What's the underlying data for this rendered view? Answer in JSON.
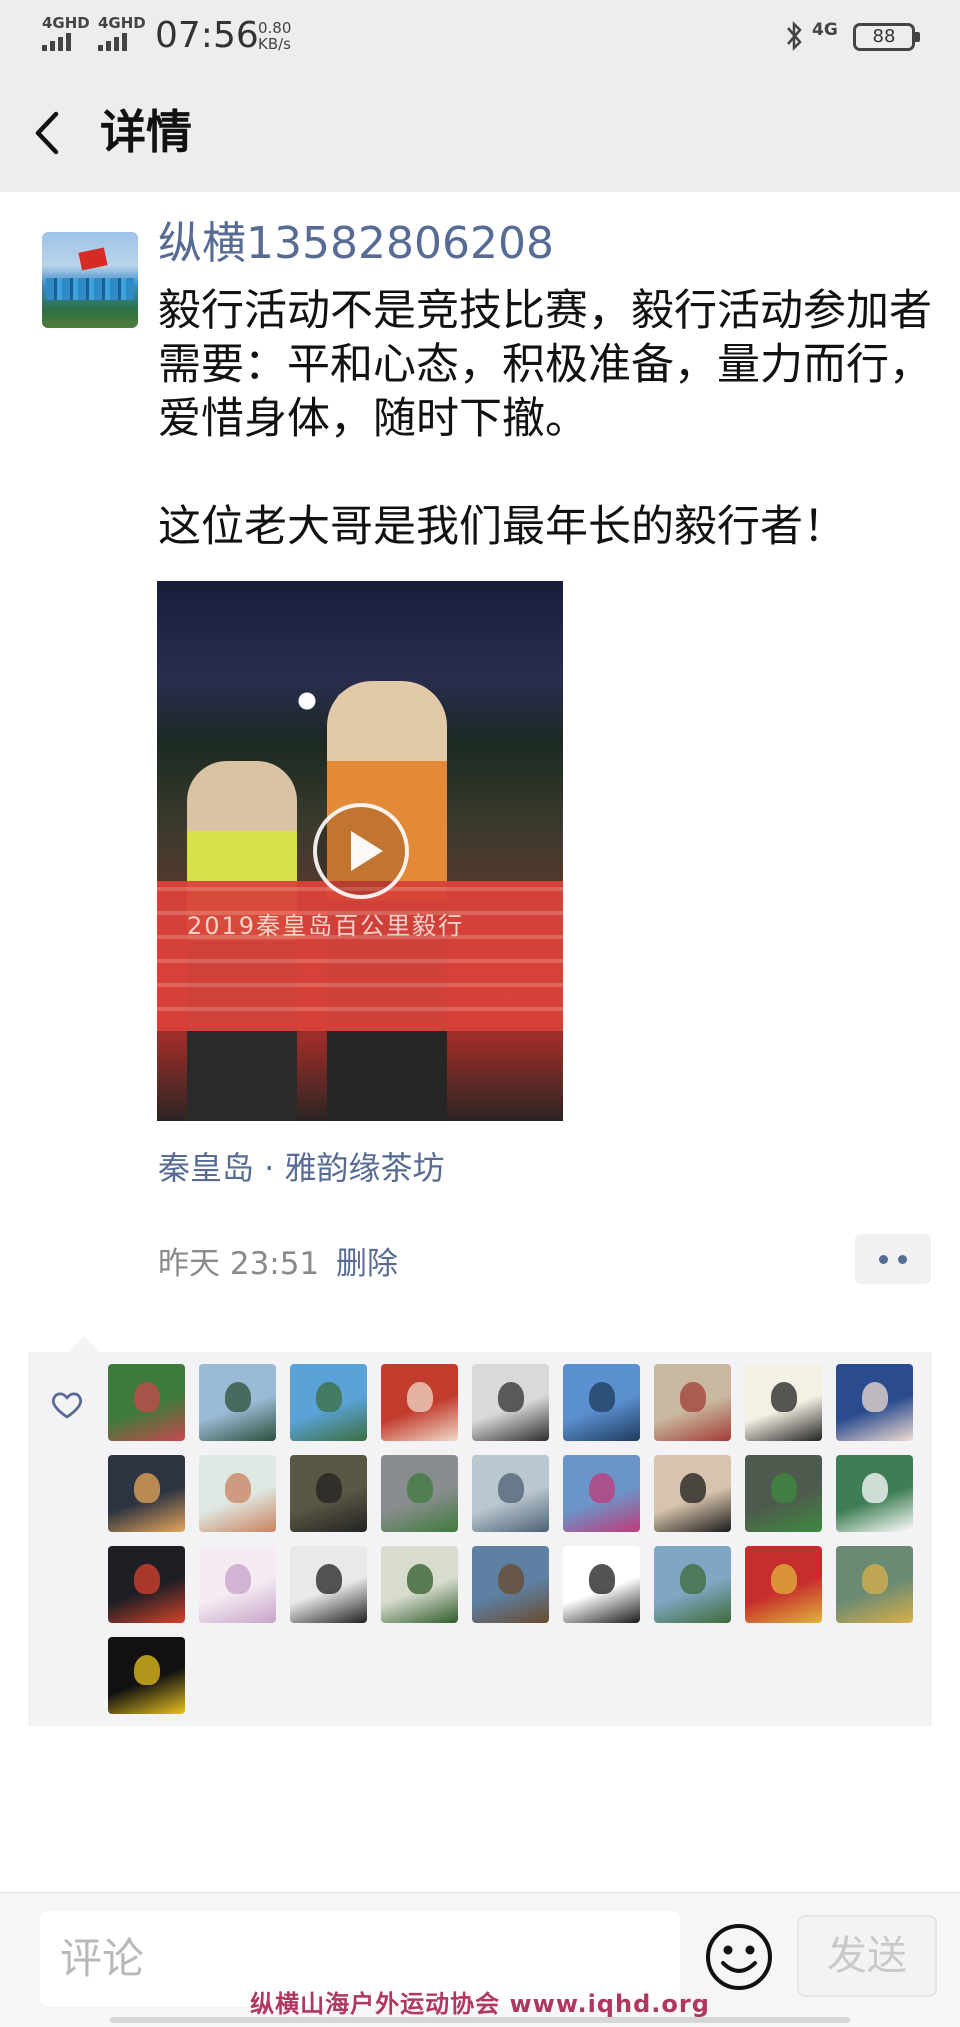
{
  "status_bar": {
    "network_label": "4GHD",
    "time": "07:56",
    "speed_value": "0.80",
    "speed_unit": "KB/s",
    "secondary_network": "4G",
    "battery": "88"
  },
  "header": {
    "title": "详情"
  },
  "post": {
    "username": "纵横13582806208",
    "text": "毅行活动不是竞技比赛，毅行活动参加者需要：平和心态，积极准备，量力而行，爱惜身体，随时下撤。\n\n这位老大哥是我们最年长的毅行者！",
    "video_overlay_text": "2019秦皇岛百公里毅行",
    "location": "秦皇岛 · 雅韵缘茶坊",
    "timestamp": "昨天 23:51",
    "delete_label": "删除"
  },
  "likes": {
    "count": 28,
    "avatars": [
      {
        "bg": "#3f7a3d",
        "accent": "#c9484b"
      },
      {
        "bg": "#9bbad6",
        "accent": "#2c4f3a"
      },
      {
        "bg": "#5aa3d9",
        "accent": "#3c6e3d"
      },
      {
        "bg": "#c23c2d",
        "accent": "#f0d9c8"
      },
      {
        "bg": "#d9d9d9",
        "accent": "#2d2d2d"
      },
      {
        "bg": "#5a8fd0",
        "accent": "#1f3b5e"
      },
      {
        "bg": "#c9b8a0",
        "accent": "#a03c35"
      },
      {
        "bg": "#f5f0e4",
        "accent": "#222222"
      },
      {
        "bg": "#2a4c8f",
        "accent": "#f2dcd2"
      },
      {
        "bg": "#2c3442",
        "accent": "#e7a55a"
      },
      {
        "bg": "#dfe8e2",
        "accent": "#c9825f"
      },
      {
        "bg": "#5b5745",
        "accent": "#222222"
      },
      {
        "bg": "#8a8d8f",
        "accent": "#3f7b3c"
      },
      {
        "bg": "#b9c7cf",
        "accent": "#4d6073"
      },
      {
        "bg": "#6b95c9",
        "accent": "#c23a7a"
      },
      {
        "bg": "#d7c4ac",
        "accent": "#1b1b1b"
      },
      {
        "bg": "#4f5a4e",
        "accent": "#3d8a3f"
      },
      {
        "bg": "#3f7e54",
        "accent": "#ffffff"
      },
      {
        "bg": "#1d1f24",
        "accent": "#d8412d"
      },
      {
        "bg": "#f4ecf2",
        "accent": "#c7a3c9"
      },
      {
        "bg": "#e9e9e9",
        "accent": "#1f1f1f"
      },
      {
        "bg": "#d8dccf",
        "accent": "#2f5b2a"
      },
      {
        "bg": "#5d80a3",
        "accent": "#6b4a2b"
      },
      {
        "bg": "#ffffff",
        "accent": "#1a1a1a"
      },
      {
        "bg": "#7fa7c3",
        "accent": "#3e6b3a"
      },
      {
        "bg": "#c72d2d",
        "accent": "#e0b43a"
      },
      {
        "bg": "#6b8a73",
        "accent": "#d8b04a"
      },
      {
        "bg": "#111111",
        "accent": "#e8c21f"
      }
    ]
  },
  "comment_bar": {
    "placeholder": "评论",
    "send_label": "发送"
  },
  "watermark": "纵横山海户外运动协会    www.iqhd.org",
  "colors": {
    "link": "#576b95",
    "header_bg": "#ededed",
    "like_panel_bg": "#f3f3f5",
    "watermark": "#b0385e"
  }
}
